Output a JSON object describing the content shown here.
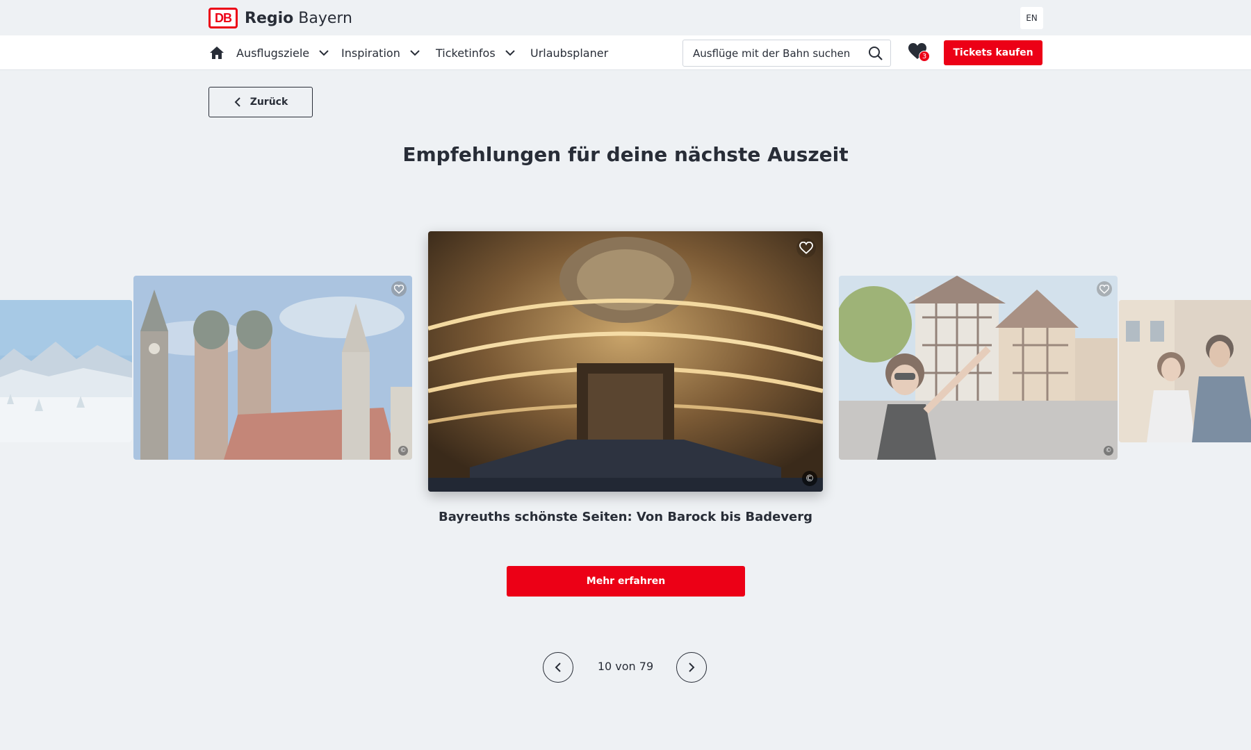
{
  "header": {
    "logo_mark": "DB",
    "brand_bold": "Regio",
    "brand_light": "Bayern",
    "language": "EN"
  },
  "nav": {
    "home_icon": "home-icon",
    "items": [
      {
        "label": "Ausflugsziele",
        "has_dropdown": true
      },
      {
        "label": "Inspiration",
        "has_dropdown": true
      },
      {
        "label": "Ticketinfos",
        "has_dropdown": true
      },
      {
        "label": "Urlaubsplaner",
        "has_dropdown": false
      }
    ],
    "search_placeholder": "Ausflüge mit der Bahn suchen",
    "favorites_count": "3",
    "tickets_label": "Tickets kaufen"
  },
  "page": {
    "back_label": "Zurück",
    "headline": "Empfehlungen für deine nächste Auszeit"
  },
  "carousel": {
    "cards": [
      {
        "scene": "Winterlandschaft mit Bergen"
      },
      {
        "scene": "München Frauenkirche"
      },
      {
        "scene": "Markgräfliches Opernhaus Bayreuth"
      },
      {
        "scene": "Fachwerkhäuser Altstadt"
      },
      {
        "scene": "Paar in der Stadt"
      }
    ],
    "active_title": "Bayreuths schönste Seiten: Von Barock bis Badeverg",
    "more_label": "Mehr erfahren",
    "copyright_symbol": "©"
  },
  "pager": {
    "text": "10 von 79"
  },
  "colors": {
    "brand_red": "#ec0016",
    "text": "#282d37",
    "background": "#eef1f4"
  }
}
